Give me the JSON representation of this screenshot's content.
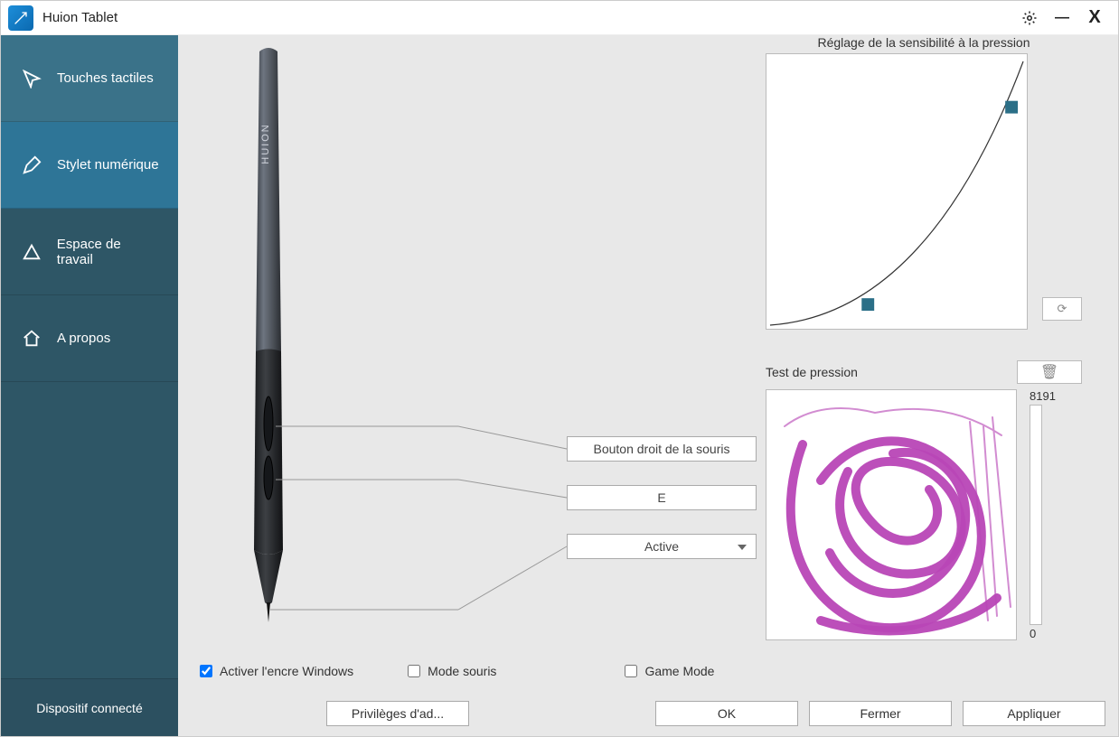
{
  "app": {
    "title": "Huion Tablet"
  },
  "sidebar": {
    "items": [
      {
        "label": "Touches tactiles"
      },
      {
        "label": "Stylet numérique"
      },
      {
        "label": "Espace de travail"
      },
      {
        "label": "A propos"
      }
    ],
    "status": "Dispositif connecté"
  },
  "pen": {
    "brand": "HUION",
    "button_top": "Bouton droit de la souris",
    "button_bottom": "E",
    "tip_mode": "Active"
  },
  "sensitivity": {
    "title": "Réglage de la sensibilité à la pression",
    "reset_label": "↻"
  },
  "pressure_test": {
    "title": "Test de pression",
    "max_value": "8191",
    "min_value": "0",
    "stroke_color": "#b846b6"
  },
  "options": {
    "windows_ink": {
      "label": "Activer l'encre Windows",
      "checked": true
    },
    "mouse_mode": {
      "label": "Mode souris",
      "checked": false
    },
    "game_mode": {
      "label": "Game Mode",
      "checked": false
    }
  },
  "buttons": {
    "admin": "Privilèges d'ad...",
    "ok": "OK",
    "close": "Fermer",
    "apply": "Appliquer"
  }
}
